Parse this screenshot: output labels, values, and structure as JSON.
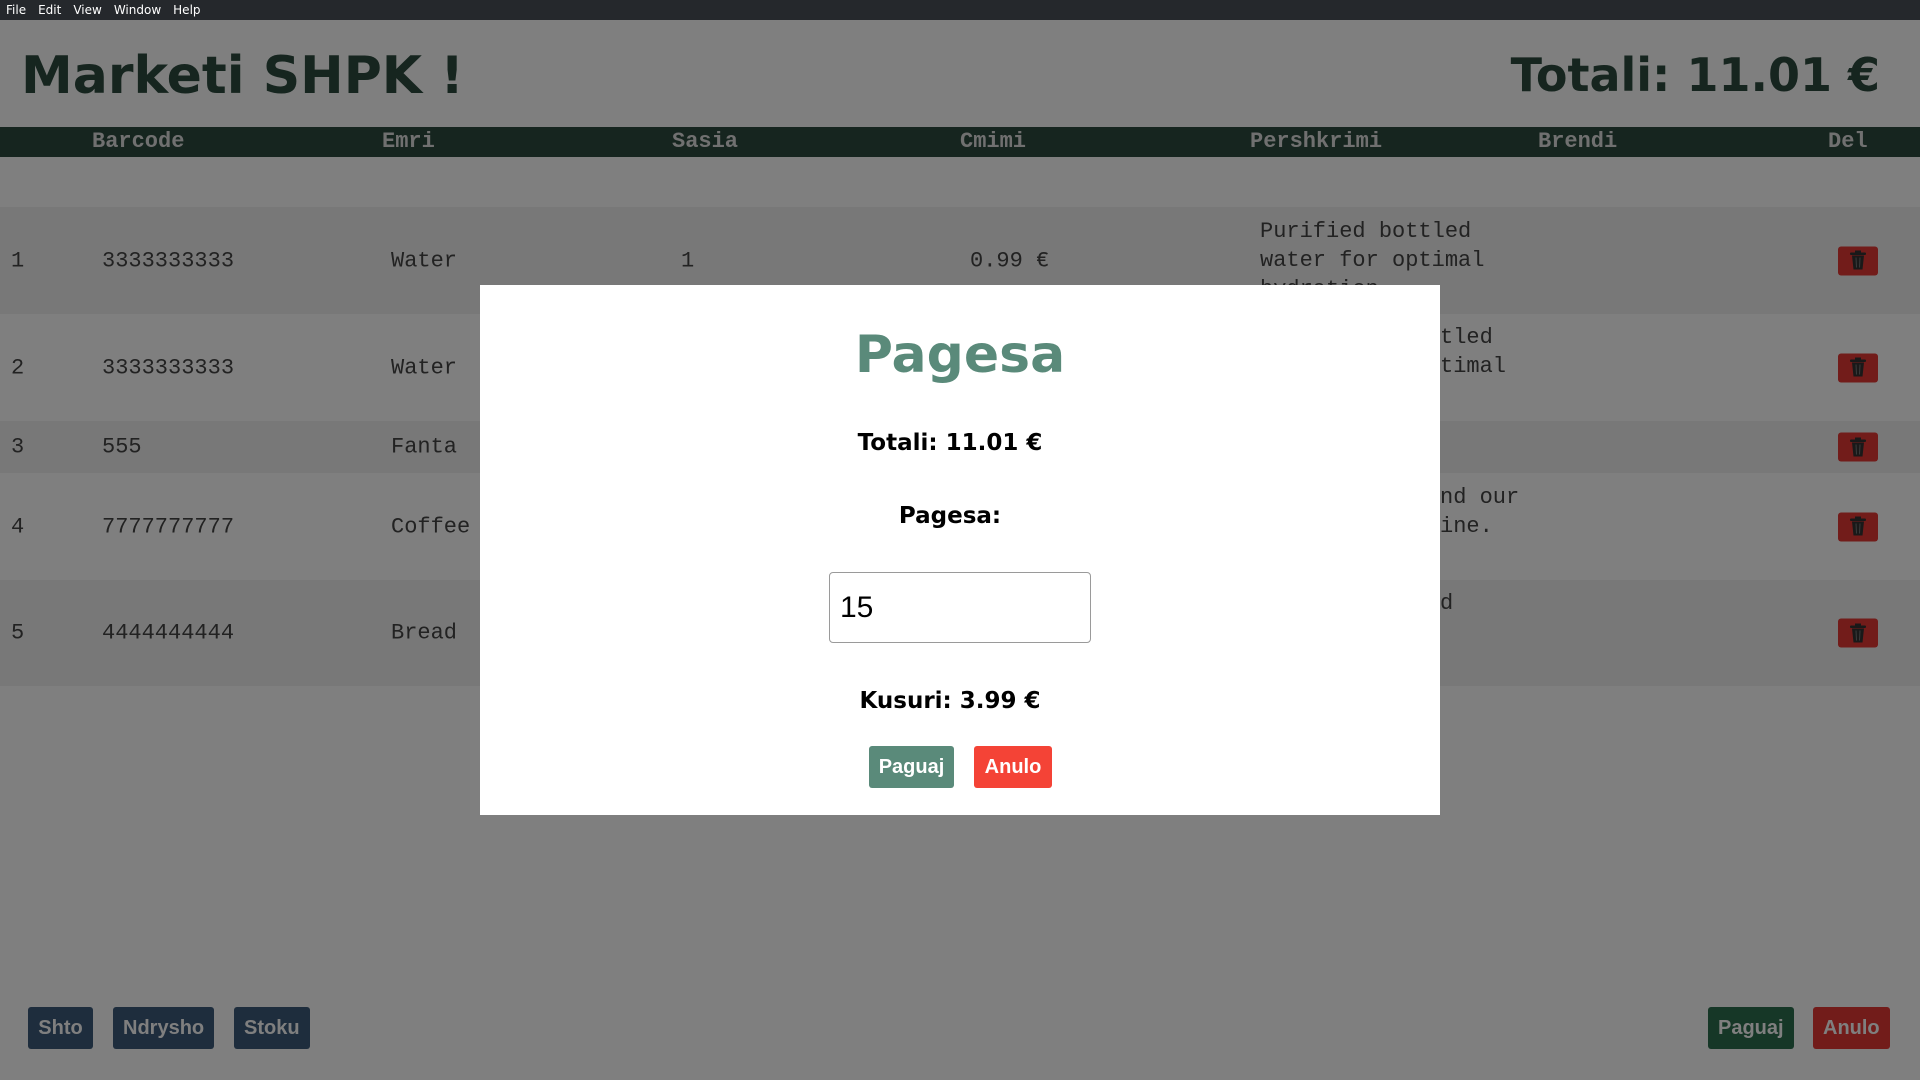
{
  "menu": [
    "File",
    "Edit",
    "View",
    "Window",
    "Help"
  ],
  "header": {
    "title": "Marketi SHPK !",
    "total": "Totali: 11.01 €"
  },
  "table": {
    "columns": [
      "Barcode",
      "Emri",
      "Sasia",
      "Cmimi",
      "Pershkrimi",
      "Brendi",
      "Del"
    ],
    "rows": [
      {
        "index": "1",
        "barcode": "3333333333",
        "name": "Water",
        "qty": "1",
        "price": "0.99 €",
        "desc": "Purified bottled water for optimal hydration.",
        "brand": ""
      },
      {
        "index": "2",
        "barcode": "3333333333",
        "name": "Water",
        "qty": "",
        "price": "",
        "desc": "tled timal",
        "brand": ""
      },
      {
        "index": "3",
        "barcode": "555",
        "name": "Fanta",
        "qty": "",
        "price": "",
        "desc": "",
        "brand": ""
      },
      {
        "index": "4",
        "barcode": "7777777777",
        "name": "Coffee",
        "qty": "",
        "price": "",
        "desc": "nd our ine.",
        "brand": ""
      },
      {
        "index": "5",
        "barcode": "4444444444",
        "name": "Bread",
        "qty": "",
        "price": "",
        "desc": "d",
        "brand": ""
      }
    ]
  },
  "footer": {
    "add": "Shto",
    "edit": "Ndrysho",
    "stock": "Stoku",
    "pay": "Paguaj",
    "cancel": "Anulo"
  },
  "modal": {
    "title": "Pagesa",
    "total": "Totali: 11.01 €",
    "payment_label": "Pagesa:",
    "payment_value": "15",
    "change": "Kusuri: 3.99 €",
    "pay_button": "Paguaj",
    "cancel_button": "Anulo"
  },
  "colors": {
    "brand_dark_green": "#2d4a3e",
    "accent_green": "#5a8a7a",
    "danger_red": "#e53935",
    "slate_button": "#3d5a7a"
  },
  "icons": {
    "delete": "trash-icon"
  }
}
